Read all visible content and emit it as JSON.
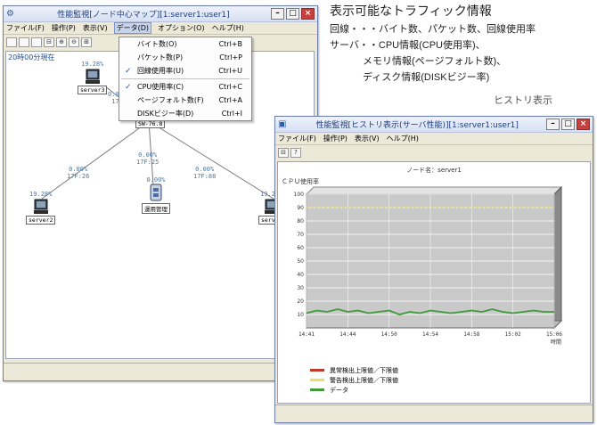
{
  "annotation": {
    "heading": "表示可能なトラフィック情報",
    "line1": "回線・・・バイト数、パケット数、回線使用率",
    "line2": "サーバ・・CPU情報(CPU使用率)、",
    "line3": "メモリ情報(ページフォルト数)、",
    "line4": "ディスク情報(DISKビジー率)",
    "history_label": "ヒストリ表示"
  },
  "window1": {
    "title": "性能監視[ノード中心マップ][1:server1:user1]",
    "menu": [
      "ファイル(F)",
      "操作(P)",
      "表示(V)",
      "データ(D)",
      "オプション(O)",
      "ヘルプ(H)"
    ],
    "time_label": "20時00分現在",
    "nodes": {
      "server3": {
        "pct": "19.28%",
        "label": "server3"
      },
      "center": {
        "label": "SW-76.8"
      },
      "server2": {
        "pct": "19.28%",
        "label": "server2"
      },
      "opsmgr": {
        "pct": "0.00%",
        "label": "運用管理"
      },
      "server_r": {
        "pct": "19.28%",
        "label": "server"
      }
    },
    "links": {
      "left": {
        "pct": "0.00%",
        "pk": "17F:26"
      },
      "mid": {
        "pct": "0.00%",
        "pk": "17F:25"
      },
      "right": {
        "pct": "0.00%",
        "pk": "17F:88"
      },
      "top": {
        "pct": "0.00%",
        "pk": "17F"
      }
    }
  },
  "dropdown": {
    "items": [
      {
        "label": "バイト数(O)",
        "shortcut": "Ctrl+B",
        "checked": false
      },
      {
        "label": "パケット数(P)",
        "shortcut": "Ctrl+P",
        "checked": false
      },
      {
        "label": "回線使用率(U)",
        "shortcut": "Ctrl+U",
        "checked": true
      },
      {
        "label": "CPU使用率(C)",
        "shortcut": "Ctrl+C",
        "checked": true
      },
      {
        "label": "ページフォルト数(F)",
        "shortcut": "Ctrl+A",
        "checked": false
      },
      {
        "label": "DISKビジー率(D)",
        "shortcut": "Ctrl+I",
        "checked": false
      }
    ]
  },
  "window2": {
    "title": "性能監視[ヒストリ表示(サーバ性能)][1:server1:user1]",
    "menu": [
      "ファイル(F)",
      "操作(P)",
      "表示(V)",
      "ヘルプ(H)"
    ],
    "node_name": "ノード名：server1",
    "ylabel": "ＣＰＵ使用率",
    "xlabel": "時間",
    "legend": [
      {
        "label": "異常検出上限値／下限値",
        "color": "#c0392b"
      },
      {
        "label": "警告検出上限値／下限値",
        "color": "#e8e06a"
      },
      {
        "label": "データ",
        "color": "#3f9a3a"
      }
    ]
  },
  "chart_data": {
    "type": "line",
    "ylabel": "ＣＰＵ使用率",
    "xlabel": "時間",
    "ylim": [
      0,
      100
    ],
    "yticks": [
      10,
      20,
      30,
      40,
      50,
      60,
      70,
      80,
      90,
      100
    ],
    "xticks": [
      "14:41",
      "14:44",
      "14:50",
      "14:54",
      "14:58",
      "15:02",
      "15:06"
    ],
    "series": [
      {
        "name": "警告検出上限値／下限値",
        "values": [
          90,
          90,
          90,
          90,
          90,
          90,
          90,
          90,
          90,
          90,
          90,
          90,
          90,
          90,
          90,
          90,
          90,
          90,
          90,
          90,
          90,
          90,
          90,
          90,
          90
        ]
      },
      {
        "name": "データ",
        "values": [
          11,
          13,
          12,
          14,
          12,
          13,
          11,
          12,
          13,
          10,
          12,
          11,
          13,
          12,
          11,
          12,
          13,
          12,
          14,
          12,
          11,
          12,
          13,
          12,
          12
        ]
      }
    ]
  }
}
